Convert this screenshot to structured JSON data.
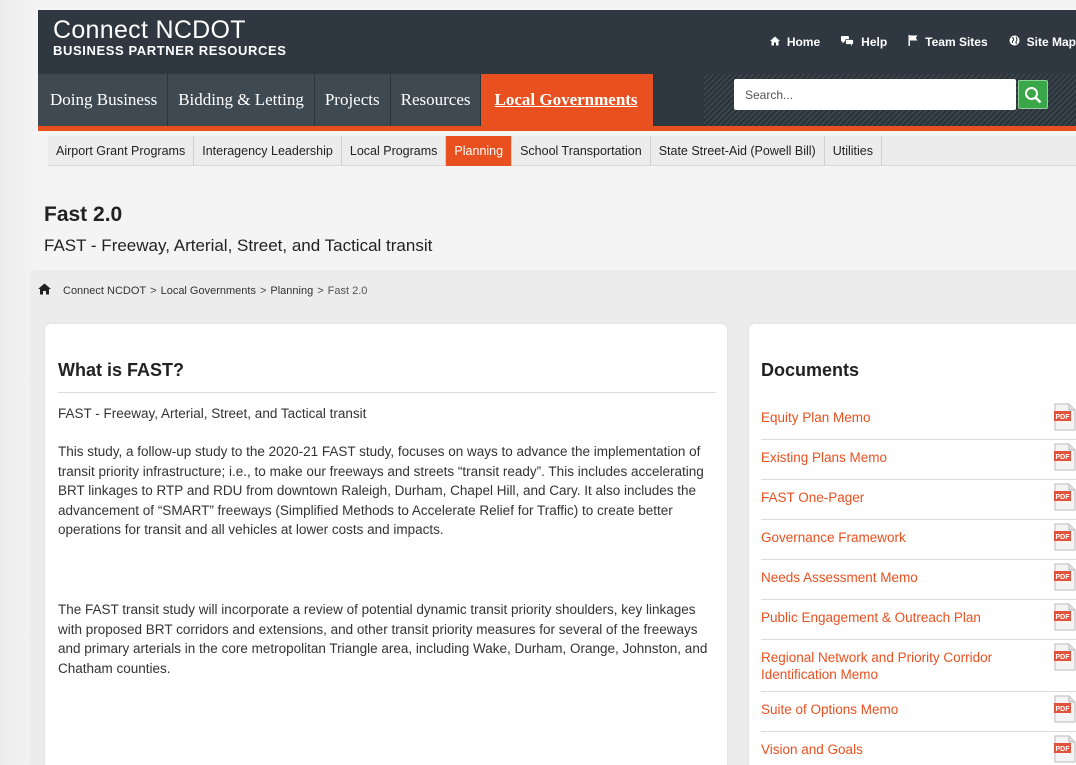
{
  "header": {
    "brand_title": "Connect NCDOT",
    "brand_subtitle": "BUSINESS PARTNER RESOURCES",
    "util_links": [
      {
        "label": "Home",
        "icon": "home-icon"
      },
      {
        "label": "Help",
        "icon": "chat-bubbles-icon"
      },
      {
        "label": "Team Sites",
        "icon": "flag-icon"
      },
      {
        "label": "Site Map",
        "icon": "globe-icon"
      }
    ]
  },
  "nav": {
    "items": [
      "Doing Business",
      "Bidding & Letting",
      "Projects",
      "Resources",
      "Local Governments"
    ],
    "active": "Local Governments"
  },
  "search": {
    "placeholder": "Search..."
  },
  "subnav": {
    "items": [
      "Airport Grant Programs",
      "Interagency Leadership",
      "Local Programs",
      "Planning",
      "School Transportation",
      "State Street-Aid (Powell Bill)",
      "Utilities"
    ],
    "active": "Planning"
  },
  "page": {
    "title": "Fast 2.0",
    "subtitle": "FAST - Freeway, Arterial, Street, and Tactical transit"
  },
  "breadcrumb": {
    "items": [
      "Connect NCDOT",
      "Local Governments",
      "Planning",
      "Fast 2.0"
    ],
    "separator": ">"
  },
  "main": {
    "heading": "What is FAST?",
    "intro": "FAST - Freeway, Arterial, Street, and Tactical transit",
    "para1": "This study, a follow-up study to the 2020-21 FAST study, focuses on ways to advance the implementation of transit priority infrastructure; i.e., to make our freeways and streets “transit ready”. This includes accelerating BRT linkages to RTP and RDU from downtown Raleigh, Durham, Chapel Hill, and Cary. It also includes the advancement of “SMART” freeways (Simplified Methods to Accelerate Relief for Traffic) to create better operations for transit and all vehicles at lower costs and impacts.",
    "para2": "The FAST transit study will incorporate a review of potential dynamic transit priority shoulders, key linkages with proposed BRT corridors and extensions, and other transit priority measures for several of the freeways and primary arterials in the core metropolitan Triangle area, including Wake, Durham, Orange, Johnston, and Chatham counties."
  },
  "documents": {
    "heading": "Documents",
    "icon_label": "PDF",
    "items": [
      "Equity Plan Memo",
      "Existing Plans Memo",
      "FAST One-Pager",
      "Governance Framework",
      "Needs Assessment Memo",
      "Public Engagement & Outreach Plan",
      "Regional Network and Priority Corridor Identification Memo",
      "Suite of Options Memo",
      "Vision and Goals"
    ]
  },
  "colors": {
    "accent": "#e9501f",
    "header_bg": "#2f3840",
    "nav_bg": "#3e4951",
    "search_green": "#3aa64a"
  }
}
